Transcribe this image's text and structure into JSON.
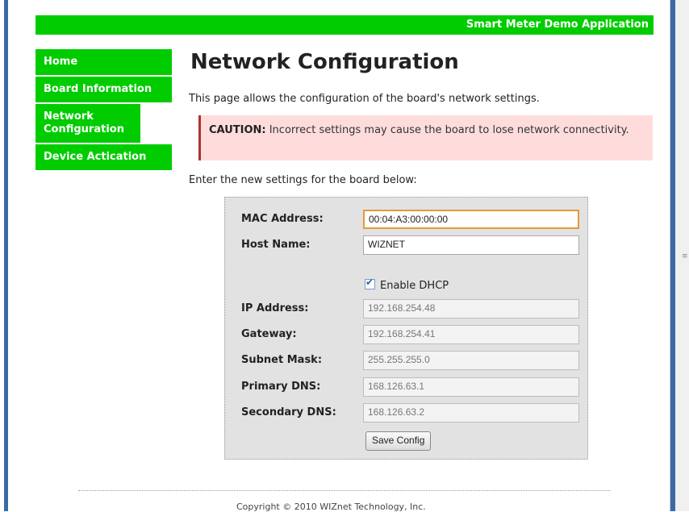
{
  "header": {
    "app_title": "Smart Meter Demo Application"
  },
  "sidebar": {
    "items": [
      {
        "label": "Home"
      },
      {
        "label": "Board Information"
      },
      {
        "label": "Network Configuration"
      },
      {
        "label": "Device Actication"
      }
    ]
  },
  "main": {
    "title": "Network Configuration",
    "intro": "This page allows the configuration of the board's network settings.",
    "caution_bold": "CAUTION:",
    "caution_text": " Incorrect settings may cause the board to lose network connectivity.",
    "enter_text": "Enter the new settings for the board below:"
  },
  "form": {
    "mac_label": "MAC Address:",
    "mac_value": "00:04:A3:00:00:00",
    "host_label": "Host Name:",
    "host_value": "WIZNET",
    "dhcp_label": "Enable DHCP",
    "dhcp_checked": true,
    "ip_label": "IP Address:",
    "ip_value": "192.168.254.48",
    "gateway_label": "Gateway:",
    "gateway_value": "192.168.254.41",
    "subnet_label": "Subnet Mask:",
    "subnet_value": "255.255.255.0",
    "dns1_label": "Primary DNS:",
    "dns1_value": "168.126.63.1",
    "dns2_label": "Secondary DNS:",
    "dns2_value": "168.126.63.2",
    "save_label": "Save Config"
  },
  "footer": {
    "copyright": "Copyright © 2010 WIZnet Technology, Inc."
  },
  "colors": {
    "accent": "#00cc00",
    "caution_bg": "#ffdcdc",
    "caution_border": "#aa3333"
  }
}
